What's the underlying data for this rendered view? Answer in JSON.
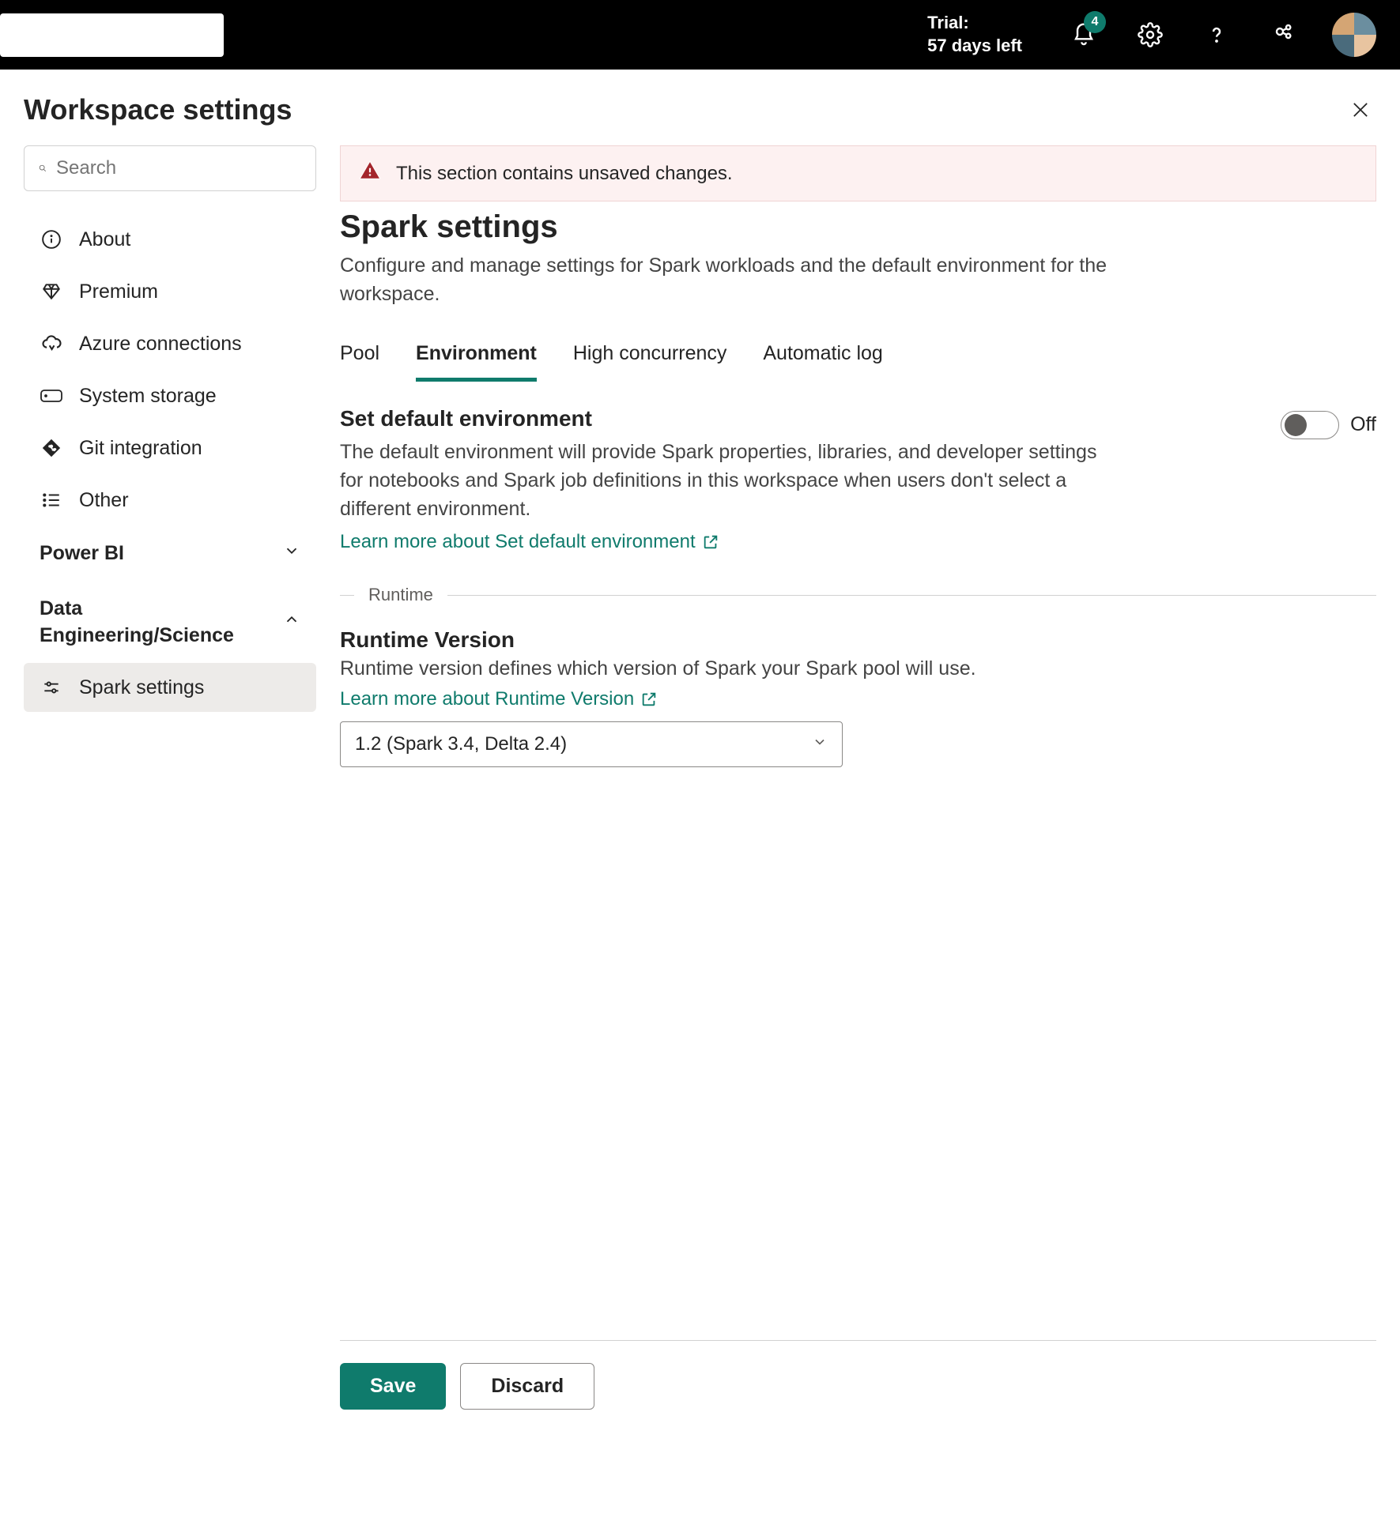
{
  "topbar": {
    "trial_label": "Trial:",
    "trial_days": "57 days left",
    "notification_count": "4"
  },
  "panel": {
    "title": "Workspace settings"
  },
  "sidebar": {
    "search_placeholder": "Search",
    "items": [
      {
        "label": "About"
      },
      {
        "label": "Premium"
      },
      {
        "label": "Azure connections"
      },
      {
        "label": "System storage"
      },
      {
        "label": "Git integration"
      },
      {
        "label": "Other"
      }
    ],
    "groups": {
      "powerbi": {
        "label": "Power BI"
      },
      "de": {
        "label": "Data Engineering/Science",
        "items": [
          {
            "label": "Spark settings"
          }
        ]
      }
    }
  },
  "content": {
    "alert": "This section contains unsaved changes.",
    "title": "Spark settings",
    "desc": "Configure and manage settings for Spark workloads and the default environment for the workspace.",
    "tabs": [
      {
        "label": "Pool"
      },
      {
        "label": "Environment"
      },
      {
        "label": "High concurrency"
      },
      {
        "label": "Automatic log"
      }
    ],
    "default_env": {
      "title": "Set default environment",
      "desc": "The default environment will provide Spark properties, libraries, and developer settings for notebooks and Spark job definitions in this workspace when users don't select a different environment.",
      "link": "Learn more about Set default environment",
      "toggle_state": "Off"
    },
    "runtime": {
      "divider_label": "Runtime",
      "title": "Runtime Version",
      "desc": "Runtime version defines which version of Spark your Spark pool will use.",
      "link": "Learn more about Runtime Version",
      "selected": "1.2 (Spark 3.4, Delta 2.4)"
    },
    "buttons": {
      "save": "Save",
      "discard": "Discard"
    }
  }
}
